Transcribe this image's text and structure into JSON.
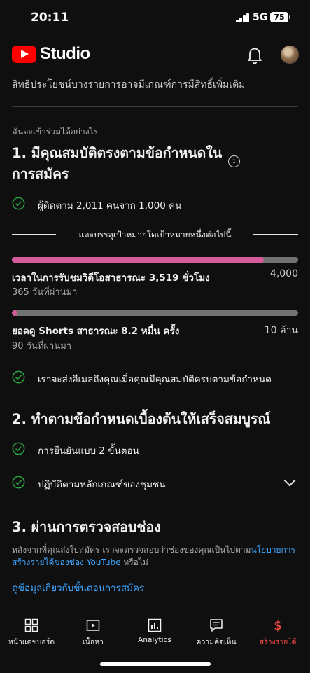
{
  "status": {
    "time": "20:11",
    "network": "5G",
    "battery": "75"
  },
  "header": {
    "app_name": "Studio"
  },
  "intro": {
    "cut_text": "สิทธิประโยชน์บางรายการอาจมีเกณฑ์การมีสิทธิ์เพิ่มเติม"
  },
  "eligibility": {
    "small_label": "ฉันจะเข้าร่วมได้อย่างไร",
    "step1": {
      "title_line1": "1. มีคุณสมบัติตรงตามข้อกำหนดใน",
      "title_line2": "การสมัคร",
      "info_icon": "i"
    },
    "subscribers": "ผู้ติดตาม 2,011 คนจาก 1,000 คน",
    "or_text": "และบรรลุเป้าหมายใดเป้าหมายหนึ่งต่อไปนี้",
    "watch_hours": {
      "label": "เวลาในการรับชมวิดีโอสาธารณะ 3,519 ชั่วโมง",
      "sub": "365 วันที่ผ่านมา",
      "target": "4,000",
      "progress": 0.88
    },
    "shorts_views": {
      "label": "ยอดดู Shorts สาธารณะ 8.2 หมื่น ครั้ง",
      "sub": "90 วันที่ผ่านมา",
      "target": "10 ล้าน",
      "progress": 0.02
    },
    "email_notice": "เราจะส่งอีเมลถึงคุณเมื่อคุณมีคุณสมบัติครบตามข้อกำหนด",
    "step2": {
      "title": "2. ทำตามข้อกำหนดเบื้องต้นให้เสร็จสมบูรณ์",
      "two_step": "การยืนยันแบบ 2 ขั้นตอน",
      "guidelines": "ปฏิบัติตามหลักเกณฑ์ของชุมชน"
    },
    "step3": {
      "title": "3. ผ่านการตรวจสอบช่อง",
      "para_line1_prefix": "หลังจากที่คุณส่งใบสมัคร เราจะตรวจสอบว่าช่องของคุณเป็นไปตาม",
      "para_line1_link": "นโยบายการ",
      "para_line2_link": "สร้างรายได้ของช่อง YouTube",
      "para_line2_suffix": " หรือไม่"
    },
    "learn_more": "ดูข้อมูลเกี่ยวกับขั้นตอนการสมัคร"
  },
  "bottom_nav": {
    "items": [
      {
        "label": "หน้าแดชบอร์ด",
        "icon": "dashboard-icon"
      },
      {
        "label": "เนื้อหา",
        "icon": "content-icon"
      },
      {
        "label": "Analytics",
        "icon": "analytics-icon"
      },
      {
        "label": "ความคิดเห็น",
        "icon": "comments-icon"
      },
      {
        "label": "สร้างรายได้",
        "icon": "earn-icon",
        "active": true
      }
    ]
  },
  "colors": {
    "accent_red": "#ff0000",
    "earn_active": "#ff4e45",
    "progress_pink": "#d75a9a",
    "link_blue": "#3ea6ff",
    "check_green": "#2ba640"
  }
}
